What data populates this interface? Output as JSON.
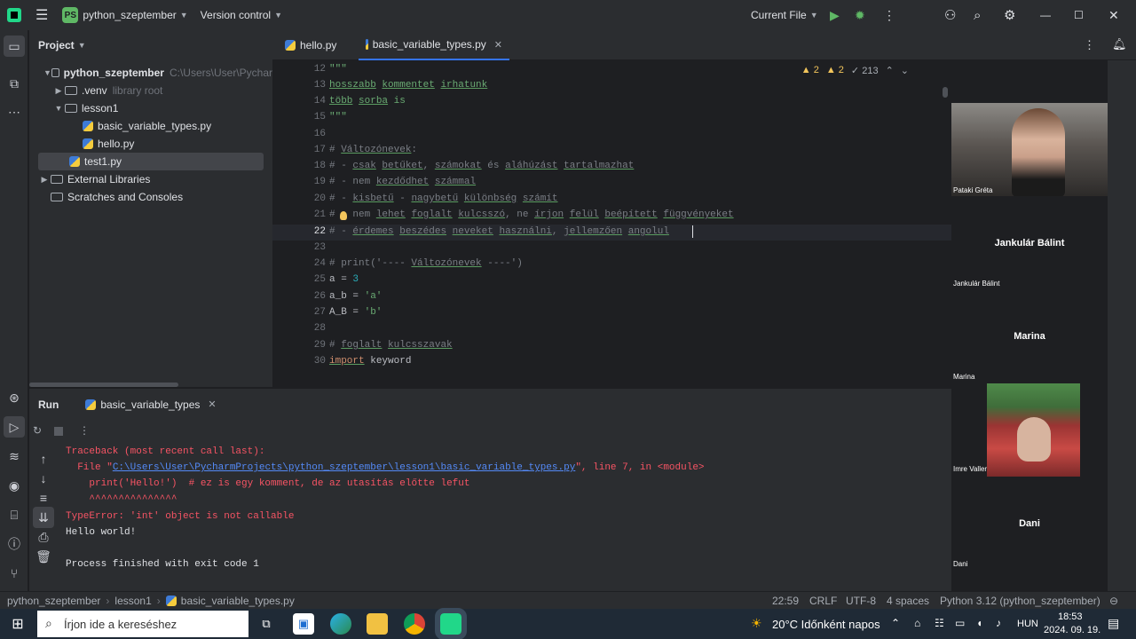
{
  "titlebar": {
    "project_badge": "PS",
    "project_name": "python_szeptember",
    "vcs": "Version control",
    "run_config": "Current File"
  },
  "project": {
    "header": "Project",
    "rows": [
      {
        "label": "python_szeptember",
        "hint": "C:\\Users\\User\\Pychar"
      },
      {
        "label": ".venv",
        "hint": "library root"
      },
      {
        "label": "lesson1"
      },
      {
        "label": "basic_variable_types.py"
      },
      {
        "label": "hello.py"
      },
      {
        "label": "test1.py"
      },
      {
        "label": "External Libraries"
      },
      {
        "label": "Scratches and Consoles"
      }
    ]
  },
  "tabs": [
    {
      "label": "hello.py"
    },
    {
      "label": "basic_variable_types.py"
    }
  ],
  "inspections": {
    "errors": "2",
    "warnings": "2",
    "weak": "213"
  },
  "code": {
    "line_numbers": [
      "12",
      "13",
      "14",
      "15",
      "16",
      "17",
      "18",
      "19",
      "20",
      "21",
      "22",
      "23",
      "24",
      "25",
      "26",
      "27",
      "28",
      "29",
      "30"
    ],
    "current_line": "22"
  },
  "run": {
    "tab_title": "Run",
    "config_name": "basic_variable_types",
    "console": [
      "Traceback (most recent call last):",
      "  File \"",
      "C:\\Users\\User\\PycharmProjects\\python_szeptember\\lesson1\\basic_variable_types.py",
      "\", line 7, in <module>",
      "    print('Hello!')  # ez is egy komment, de az utasítás előtte lefut",
      "    ^^^^^^^^^^^^^^^",
      "TypeError: 'int' object is not callable",
      "Hello world!",
      "Process finished with exit code 1"
    ]
  },
  "meeting": {
    "participants": [
      {
        "name": "Pataki Gréta"
      },
      {
        "name": "Jankulár Bálint"
      },
      {
        "name": "Marina"
      },
      {
        "name": "Imre Valler"
      },
      {
        "name": "Dani"
      }
    ]
  },
  "statusbar": {
    "crumbs": [
      "python_szeptember",
      "lesson1",
      "basic_variable_types.py"
    ],
    "position": "22:59",
    "line_sep": "CRLF",
    "encoding": "UTF-8",
    "indent": "4 spaces",
    "interpreter": "Python 3.12 (python_szeptember)"
  },
  "taskbar": {
    "search_placeholder": "Írjon ide a kereséshez",
    "weather": "20°C  Időnként napos",
    "lang": "HUN",
    "time": "18:53",
    "date": "2024. 09. 19."
  },
  "colors": {
    "accent": "#3574f0",
    "error": "#f75464",
    "string": "#6aab73",
    "comment": "#7a7e85"
  }
}
